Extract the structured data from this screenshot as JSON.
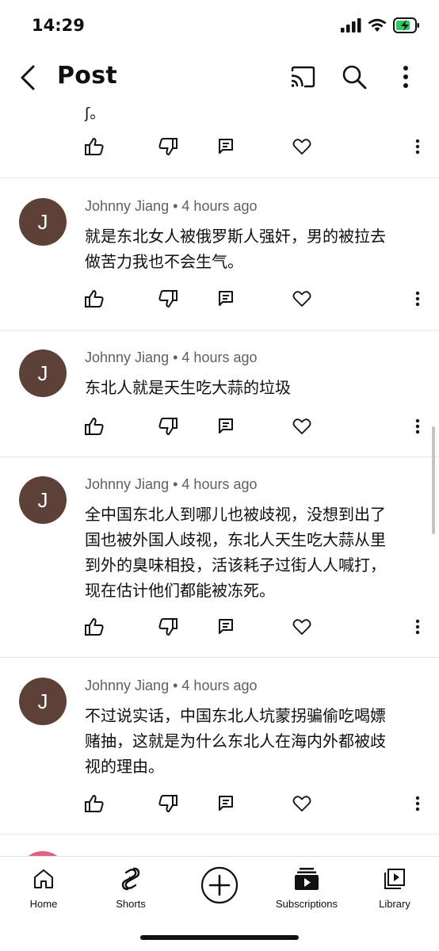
{
  "status": {
    "time": "14:29"
  },
  "header": {
    "title": "Post"
  },
  "partial_comment": {
    "text": "ʃ。"
  },
  "comments": [
    {
      "avatar_letter": "J",
      "author": "Johnny Jiang",
      "time": "4 hours ago",
      "text_lines": [
        "就是东北女人被俄罗斯人强奸，男的被拉去",
        "做苦力我也不会生气。"
      ]
    },
    {
      "avatar_letter": "J",
      "author": "Johnny Jiang",
      "time": "4 hours ago",
      "text_lines": [
        "东北人就是天生吃大蒜的垃圾"
      ]
    },
    {
      "avatar_letter": "J",
      "author": "Johnny Jiang",
      "time": "4 hours ago",
      "text_lines": [
        "全中国东北人到哪儿也被歧视，没想到出了",
        "国也被外国人歧视，东北人天生吃大蒜从里",
        "到外的臭味相投，活该耗子过街人人喊打，",
        "现在估计他们都能被冻死。"
      ]
    },
    {
      "avatar_letter": "J",
      "author": "Johnny Jiang",
      "time": "4 hours ago",
      "text_lines": [
        "不过说实话，中国东北人坑蒙拐骗偷吃喝嫖",
        "赌抽，这就是为什么东北人在海内外都被歧",
        "视的理由。"
      ]
    }
  ],
  "meta_separator": "•",
  "bottom_nav": {
    "home": "Home",
    "shorts": "Shorts",
    "subscriptions": "Subscriptions",
    "library": "Library"
  },
  "colors": {
    "avatar_bg": "#5d4037",
    "peek_avatar_bg": "#e06283",
    "battery_green": "#30c85a",
    "meta_gray": "#606060"
  }
}
